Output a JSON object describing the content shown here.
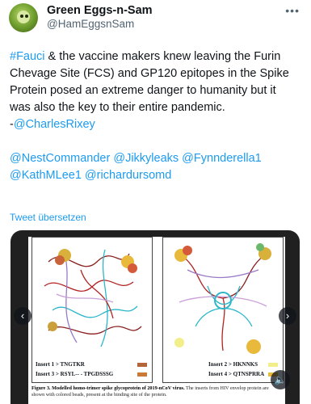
{
  "author": {
    "display_name": "Green Eggs-n-Sam",
    "handle": "@HamEggsnSam",
    "avatar_icon": "avatar-cartoon"
  },
  "more_icon": "more-options-icon",
  "tweet": {
    "hashtag": "#Fauci",
    "text_part1": " & the vaccine makers knew leaving the Furin Chevage Site (FCS) and GP120 epitopes in the Spike Protein posed an extreme danger to humanity but it was also the key to their entire pandemic.",
    "dash": "-",
    "mention_author": "@CharlesRixey",
    "mentions": [
      "@NestCommander",
      "@Jikkyleaks",
      "@Fynnderella1",
      "@KathMLee1",
      "@richardursomd"
    ]
  },
  "translate_label": "Tweet übersetzen",
  "media": {
    "legend": {
      "insert1": "Insert 1 > TNGTKR",
      "insert2": "Insert 2 > HKNNKS",
      "insert3": "Insert 3 > RSYL-- - TPGDSSSG",
      "insert4": "Insert 4 > QTNSPRRA",
      "colors": {
        "insert1": "#b5653a",
        "insert2": "#f2ef8a",
        "insert3": "#c97a38",
        "insert4": "#e8b93a"
      }
    },
    "caption_bold": "Figure 3. Modelled homo-trimer spike glycoprotein of 2019-nCoV virus.",
    "caption_rest": " The inserts from HIV envelop protein are shown with colored beads, present at the binding site of the protein."
  }
}
